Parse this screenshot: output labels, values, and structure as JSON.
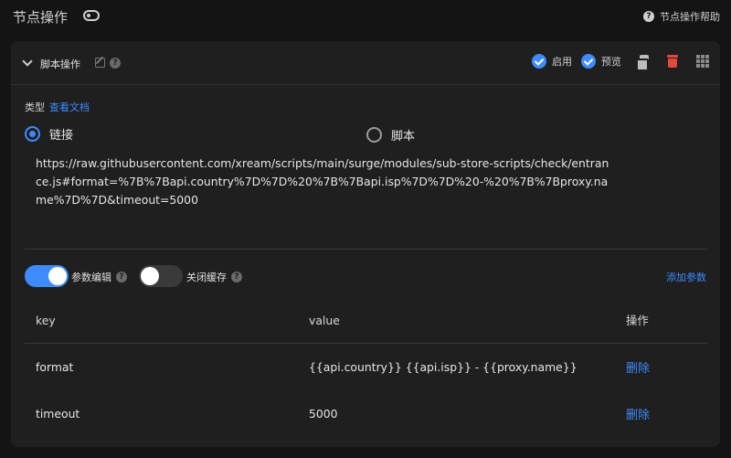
{
  "page": {
    "title": "节点操作",
    "help_label": "节点操作帮助"
  },
  "card": {
    "title": "脚本操作",
    "enable_label": "启用",
    "preview_label": "预览"
  },
  "type_section": {
    "label": "类型",
    "doc_link": "查看文档",
    "options": [
      {
        "label": "链接",
        "selected": true
      },
      {
        "label": "脚本",
        "selected": false
      }
    ],
    "url": "https://raw.githubusercontent.com/xream/scripts/main/surge/modules/sub-store-scripts/check/entrance.js#format=%7B%7Bapi.country%7D%7D%20%7B%7Bapi.isp%7D%7D%20-%20%7B%7Bproxy.name%7D%7D&timeout=5000"
  },
  "params": {
    "edit_label": "参数编辑",
    "edit_on": true,
    "cache_label": "关闭缓存",
    "cache_on": false,
    "add_label": "添加参数",
    "columns": [
      "key",
      "value",
      "操作"
    ],
    "rows": [
      {
        "key": "format",
        "value": "{{api.country}} {{api.isp}} - {{proxy.name}}",
        "action": "删除"
      },
      {
        "key": "timeout",
        "value": "5000",
        "action": "删除"
      }
    ]
  },
  "colors": {
    "accent": "#3d8bfd",
    "danger": "#e0493c",
    "background": "#141414",
    "card": "#1f1f1f"
  },
  "icons": [
    "toggle-icon",
    "help-icon",
    "chevron-down-icon",
    "edit-icon",
    "check-circle-icon",
    "copy-icon",
    "trash-icon",
    "drag-grid-icon"
  ]
}
